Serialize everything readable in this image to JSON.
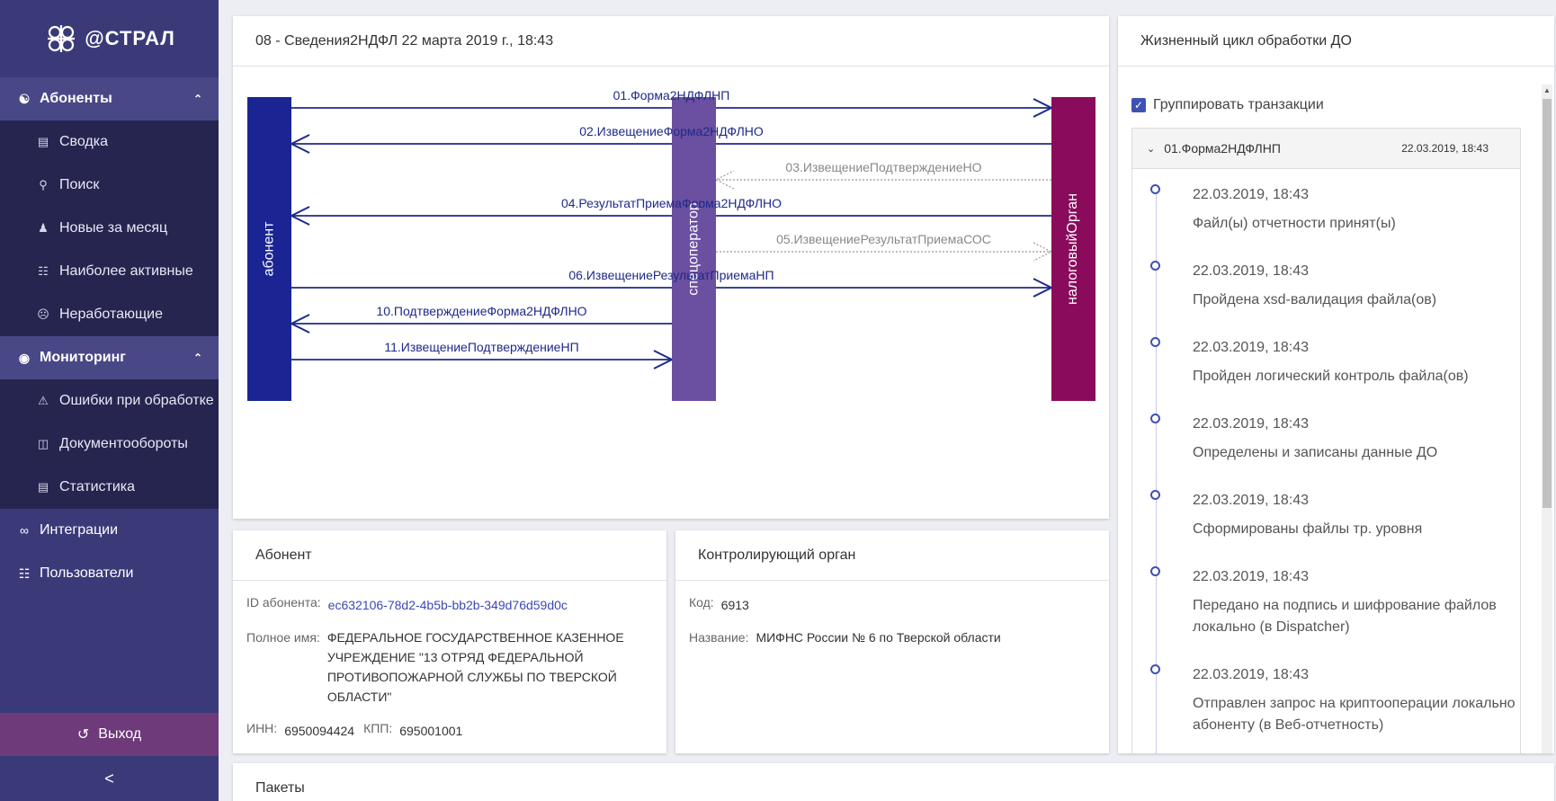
{
  "sidebar": {
    "logo_text": "@СТРАЛ",
    "sections": [
      {
        "label": "Абоненты",
        "icon": "user-icon"
      },
      {
        "label": "Мониторинг",
        "icon": "eye-icon"
      }
    ],
    "subscribers_items": [
      {
        "label": "Сводка",
        "icon": "bar-chart-icon"
      },
      {
        "label": "Поиск",
        "icon": "search-icon"
      },
      {
        "label": "Новые за месяц",
        "icon": "user-plus-icon"
      },
      {
        "label": "Наиболее активные",
        "icon": "list-icon"
      },
      {
        "label": "Неработающие",
        "icon": "sad-face-icon"
      }
    ],
    "monitoring_items": [
      {
        "label": "Ошибки при обработке",
        "icon": "warning-icon"
      },
      {
        "label": "Документообороты",
        "icon": "document-icon"
      },
      {
        "label": "Статистика",
        "icon": "chart-icon"
      }
    ],
    "plain_items": [
      {
        "label": "Интеграции",
        "icon": "link-icon"
      },
      {
        "label": "Пользователи",
        "icon": "users-list-icon"
      }
    ],
    "logout_label": "Выход",
    "collapse_glyph": "<"
  },
  "diagram": {
    "title": "08 - Сведения2НДФЛ 22 марта 2019 г., 18:43",
    "lanes": [
      "абонент",
      "спецоператор",
      "налоговыйОрган"
    ],
    "lane_colors": [
      "#1a2593",
      "#6b4fa0",
      "#8a0b5c"
    ],
    "messages": [
      {
        "label": "01.Форма2НДФЛНП",
        "from": 0,
        "to": 2,
        "style": "solid"
      },
      {
        "label": "02.ИзвещениеФорма2НДФЛНО",
        "from": 2,
        "to": 0,
        "style": "solid"
      },
      {
        "label": "03.ИзвещениеПодтверждениеНО",
        "from": 2,
        "to": 1,
        "style": "dashed"
      },
      {
        "label": "04.РезультатПриемаФорма2НДФЛНО",
        "from": 2,
        "to": 0,
        "style": "solid"
      },
      {
        "label": "05.ИзвещениеРезультатПриемаСОС",
        "from": 1,
        "to": 2,
        "style": "dashed"
      },
      {
        "label": "06.ИзвещениеРезультатПриемаНП",
        "from": 0,
        "to": 2,
        "style": "solid"
      },
      {
        "label": "10.ПодтверждениеФорма2НДФЛНО",
        "from": 1,
        "to": 0,
        "style": "solid"
      },
      {
        "label": "11.ИзвещениеПодтверждениеНП",
        "from": 0,
        "to": 1,
        "style": "solid"
      }
    ]
  },
  "subscriber": {
    "title": "Абонент",
    "id_label": "ID абонента:",
    "id_value": "ec632106-78d2-4b5b-bb2b-349d76d59d0c",
    "fullname_label": "Полное имя:",
    "fullname_value": "ФЕДЕРАЛЬНОЕ ГОСУДАРСТВЕННОЕ КАЗЕННОЕ УЧРЕЖДЕНИЕ \"13 ОТРЯД ФЕДЕРАЛЬНОЙ ПРОТИВОПОЖАРНОЙ СЛУЖБЫ ПО ТВЕРСКОЙ ОБЛАСТИ\"",
    "inn_label": "ИНН:",
    "inn_value": "6950094424",
    "kpp_label": "КПП:",
    "kpp_value": "695001001"
  },
  "authority": {
    "title": "Контролирующий орган",
    "code_label": "Код:",
    "code_value": "6913",
    "name_label": "Название:",
    "name_value": "МИФНС России № 6 по Тверской области"
  },
  "lifecycle": {
    "title": "Жизненный цикл обработки ДО",
    "group_label": "Группировать транзакции",
    "group_checked": true,
    "group_name": "01.Форма2НДФЛНП",
    "group_date": "22.03.2019, 18:43",
    "events": [
      {
        "date": "22.03.2019, 18:43",
        "text": "Файл(ы) отчетности принят(ы)"
      },
      {
        "date": "22.03.2019, 18:43",
        "text": "Пройдена xsd-валидация файла(ов)"
      },
      {
        "date": "22.03.2019, 18:43",
        "text": "Пройден логический контроль файла(ов)"
      },
      {
        "date": "22.03.2019, 18:43",
        "text": "Определены и записаны данные ДО"
      },
      {
        "date": "22.03.2019, 18:43",
        "text": "Сформированы файлы тр. уровня"
      },
      {
        "date": "22.03.2019, 18:43",
        "text": "Передано на подпись и шифрование файлов локально (в Dispatcher)"
      },
      {
        "date": "22.03.2019, 18:43",
        "text": "Отправлен запрос на криптооперации локально абоненту (в Веб-отчетность)"
      }
    ]
  },
  "packages": {
    "title": "Пакеты"
  },
  "colors": {
    "sidebar_bg": "#3b3a79",
    "accent": "#3f51b5",
    "logout_bg": "#6e3a7a"
  }
}
